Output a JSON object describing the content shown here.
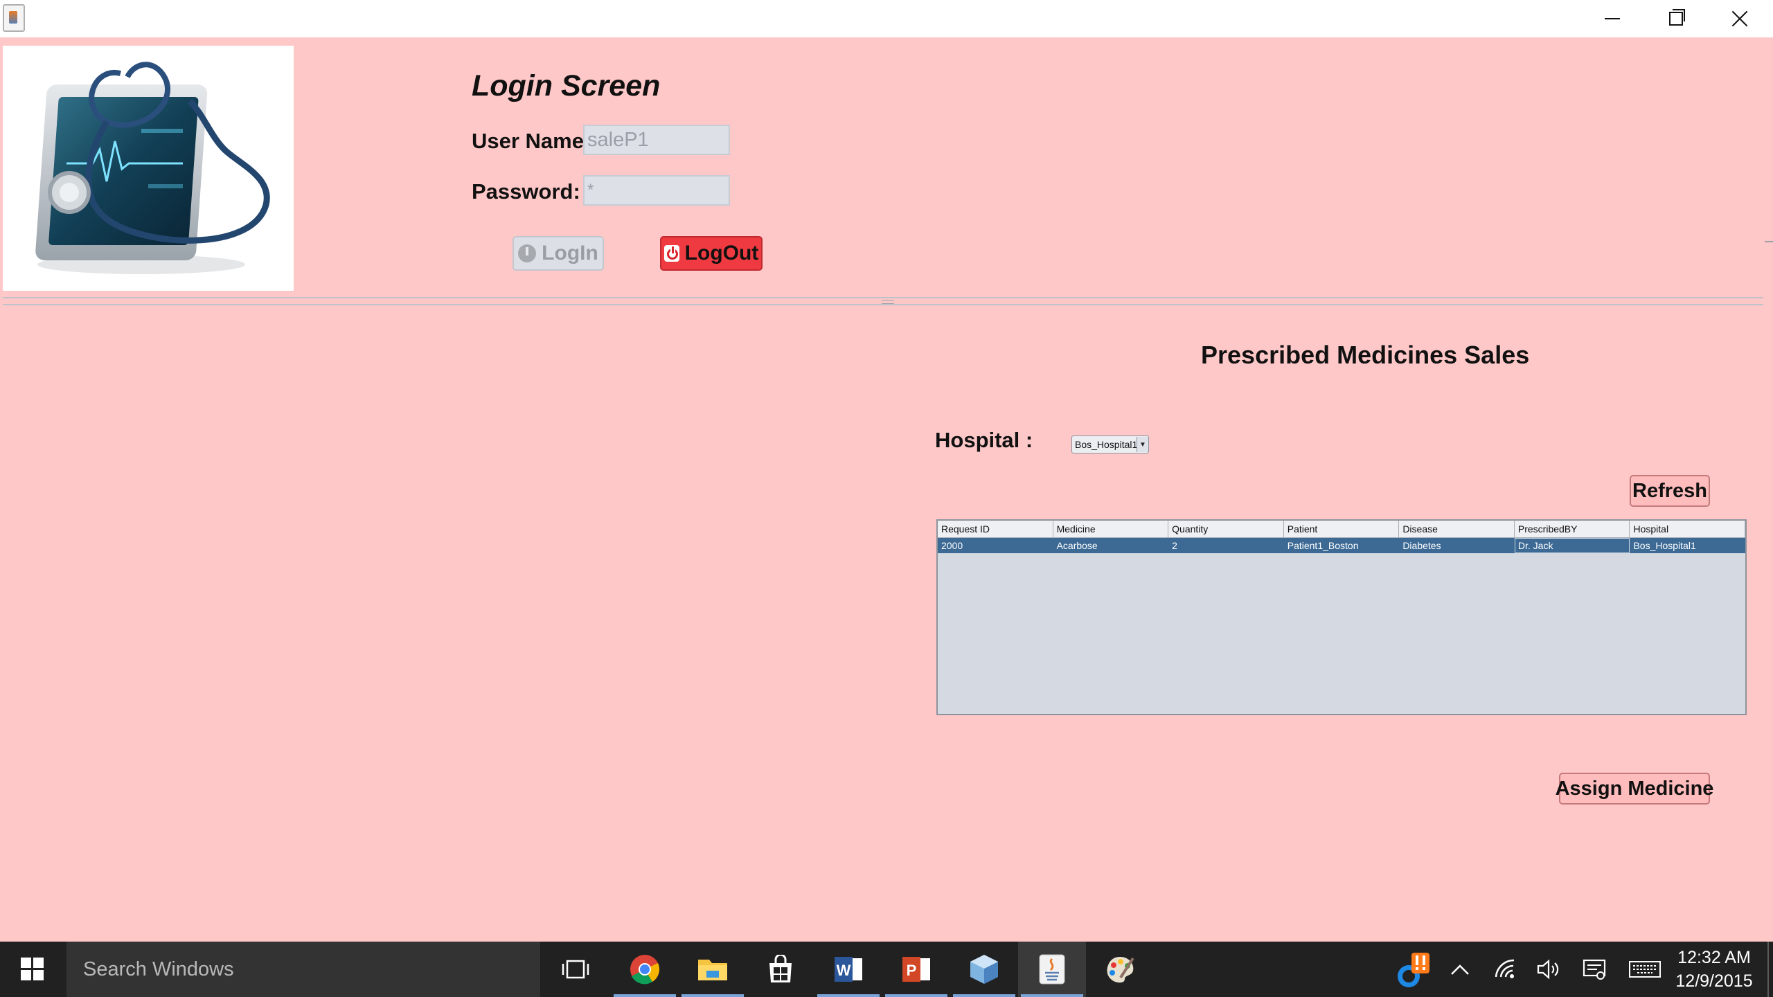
{
  "login": {
    "title": "Login Screen",
    "username_label": "User Name :",
    "username_value": "saleP1",
    "password_label": "Password:",
    "password_value": "*",
    "login_button": "LogIn",
    "logout_button": "LogOut"
  },
  "sales": {
    "title": "Prescribed Medicines Sales",
    "hospital_label": "Hospital :",
    "hospital_selected": "Bos_Hospital1",
    "refresh_button": "Refresh",
    "assign_button": "Assign Medicine",
    "table": {
      "columns": [
        "Request ID",
        "Medicine",
        "Quantity",
        "Patient",
        "Disease",
        "PrescribedBY",
        "Hospital"
      ],
      "rows": [
        [
          "2000",
          "Acarbose",
          "2",
          "Patient1_Boston",
          "Diabetes",
          "Dr. Jack",
          "Bos_Hospital1"
        ]
      ],
      "selected_row": 0
    }
  },
  "taskbar": {
    "search_placeholder": "Search Windows",
    "clock_time": "12:32 AM",
    "clock_date": "12/9/2015",
    "apps": [
      "task-view-icon",
      "chrome-icon",
      "file-explorer-icon",
      "store-icon",
      "word-icon",
      "powerpoint-icon",
      "virtualbox-icon",
      "java-icon",
      "paint-icon"
    ],
    "tray": [
      "notification-badge-icon",
      "chevron-up-icon",
      "wifi-icon",
      "volume-icon",
      "action-center-icon",
      "keyboard-icon"
    ]
  },
  "colors": {
    "background": "#ffc8c8",
    "logout_button": "#ee3a40",
    "selected_row": "#3c6a95",
    "taskbar": "#212121"
  }
}
